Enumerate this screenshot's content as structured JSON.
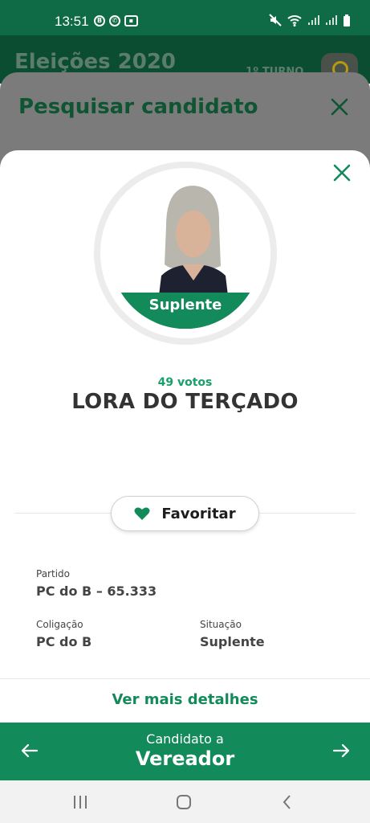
{
  "status_bar": {
    "time": "13:51",
    "notification_icons": [
      "b-icon",
      "whatsapp-icon",
      "teams-icon"
    ],
    "right_icons": [
      "mute-icon",
      "wifi-icon",
      "signal-icon",
      "signal-icon",
      "battery-icon"
    ]
  },
  "background_header": {
    "title": "Eleições 2020",
    "turno": "1º TURNO"
  },
  "search_sheet": {
    "title": "Pesquisar candidato"
  },
  "candidate": {
    "status": "Suplente",
    "votes": "49 votos",
    "name": "LORA DO TERÇADO"
  },
  "favorite": {
    "label": "Favoritar"
  },
  "info": {
    "partido_label": "Partido",
    "partido_value": "PC do B – 65.333",
    "coligacao_label": "Coligação",
    "coligacao_value": "PC do B",
    "situacao_label": "Situação",
    "situacao_value": "Suplente"
  },
  "details_link": "Ver mais detalhes",
  "footer": {
    "subtitle": "Candidato a",
    "office": "Vereador"
  },
  "colors": {
    "primary": "#128a5a",
    "status_bar": "#0f6b45",
    "text_dark": "#333333"
  }
}
